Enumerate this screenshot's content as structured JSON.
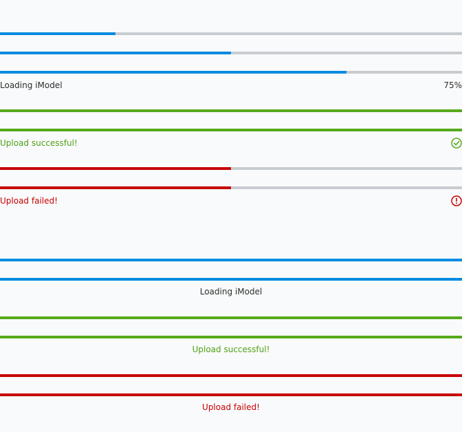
{
  "colors": {
    "informational": "#008be1",
    "positive": "#56aa1c",
    "negative": "#c60000",
    "track": "#c7ccd1",
    "text": "#2c2c2c"
  },
  "bars": {
    "bar1": {
      "progress": 0.25,
      "status": "informational"
    },
    "bar2": {
      "progress": 0.5,
      "status": "informational"
    },
    "bar3": {
      "progress": 0.75,
      "status": "informational"
    },
    "bar4": {
      "progress": 1.0,
      "status": "positive"
    },
    "bar5": {
      "progress": 1.0,
      "status": "positive"
    },
    "bar6": {
      "progress": 0.5,
      "status": "negative"
    },
    "bar7": {
      "progress": 0.5,
      "status": "negative"
    },
    "bar8": {
      "progress": 1.0,
      "status": "informational"
    },
    "bar9": {
      "progress": 1.0,
      "status": "informational"
    },
    "bar10": {
      "progress": 1.0,
      "status": "positive"
    },
    "bar11": {
      "progress": 1.0,
      "status": "positive"
    },
    "bar12": {
      "progress": 1.0,
      "status": "negative"
    },
    "bar13": {
      "progress": 1.0,
      "status": "negative"
    }
  },
  "labels": {
    "loading": "Loading iModel",
    "loading_value": "75%",
    "success": "Upload successful!",
    "success_icon": "checkmark-circle-icon",
    "failed": "Upload failed!",
    "failed_icon": "status-error-icon",
    "center_loading": "Loading iModel",
    "center_success": "Upload successful!",
    "center_failed": "Upload failed!"
  }
}
